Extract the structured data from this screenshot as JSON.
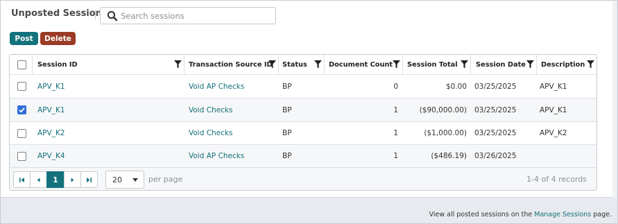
{
  "header": {
    "title": "Unposted Sessions"
  },
  "search": {
    "placeholder": "Search sessions",
    "value": ""
  },
  "toolbar": {
    "post_label": "Post",
    "delete_label": "Delete"
  },
  "table": {
    "columns": [
      "Session ID",
      "Transaction Source ID",
      "Status",
      "Document Count",
      "Session Total",
      "Session Date",
      "Description"
    ],
    "rows": [
      {
        "checked": false,
        "session_id": "APV_K1",
        "source_id": "Void AP Checks",
        "status": "BP",
        "doc_count": "0",
        "total": "$0.00",
        "date": "03/25/2025",
        "description": "APV_K1"
      },
      {
        "checked": true,
        "session_id": "APV_K1",
        "source_id": "Void Checks",
        "status": "BP",
        "doc_count": "1",
        "total": "($90,000.00)",
        "date": "03/25/2025",
        "description": "APV_K1"
      },
      {
        "checked": false,
        "session_id": "APV_K2",
        "source_id": "Void Checks",
        "status": "BP",
        "doc_count": "1",
        "total": "($1,000.00)",
        "date": "03/25/2025",
        "description": "APV_K2"
      },
      {
        "checked": false,
        "session_id": "APV_K4",
        "source_id": "Void AP Checks",
        "status": "BP",
        "doc_count": "1",
        "total": "($486.19)",
        "date": "03/26/2025",
        "description": ""
      }
    ]
  },
  "pager": {
    "current_page": "1",
    "page_size": "20",
    "per_page_label": "per page",
    "records_text": "1-4 of 4 records"
  },
  "footer": {
    "prefix": "View all posted sessions on the ",
    "link": "Manage Sessions",
    "suffix": " page."
  },
  "icons": [
    "search-icon",
    "filter-icon",
    "first-page-icon",
    "previous-page-icon",
    "next-page-icon",
    "last-page-icon",
    "chevron-down-icon",
    "checkmark-icon"
  ],
  "colors": {
    "accent": "#14727c",
    "delete": "#9a3b26",
    "link": "#13707a",
    "checkbox_checked": "#2f6fd8"
  }
}
